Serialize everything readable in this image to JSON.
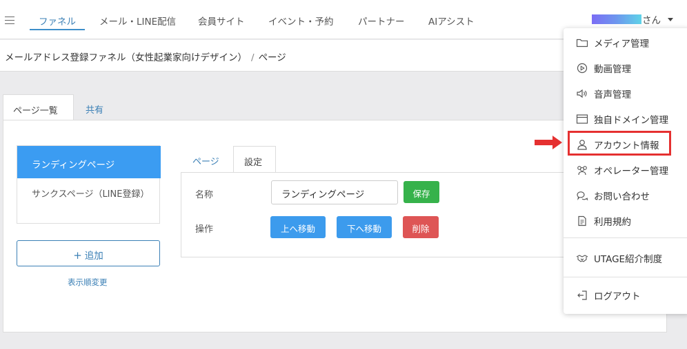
{
  "nav": {
    "tabs": [
      "ファネル",
      "メール・LINE配信",
      "会員サイト",
      "イベント・予約",
      "パートナー",
      "AIアシスト"
    ],
    "user_suffix": "さん"
  },
  "breadcrumb": {
    "funnel": "メールアドレス登録ファネル（女性起業家向けデザイン）",
    "separator": "/",
    "current": "ページ"
  },
  "page_tabs": [
    "ページ一覧",
    "共有"
  ],
  "page_list": {
    "items": [
      "ランディングページ",
      "サンクスページ（LINE登録）"
    ],
    "add_label": "追加",
    "reorder_label": "表示順変更"
  },
  "inner_tabs": [
    "ページ",
    "設定"
  ],
  "form": {
    "name_label": "名称",
    "name_value": "ランディングページ",
    "save_label": "保存",
    "ops_label": "操作",
    "move_up_label": "上へ移動",
    "move_down_label": "下へ移動",
    "delete_label": "削除"
  },
  "menu": {
    "items": [
      {
        "label": "メディア管理",
        "icon": "folder-icon"
      },
      {
        "label": "動画管理",
        "icon": "play-circle-icon"
      },
      {
        "label": "音声管理",
        "icon": "speaker-icon"
      },
      {
        "label": "独自ドメイン管理",
        "icon": "browser-window-icon"
      },
      {
        "label": "アカウント情報",
        "icon": "user-icon"
      },
      {
        "label": "オペレーター管理",
        "icon": "users-icon"
      },
      {
        "label": "お問い合わせ",
        "icon": "chat-bubbles-icon"
      },
      {
        "label": "利用規約",
        "icon": "document-icon"
      },
      {
        "label": "UTAGE紹介制度",
        "icon": "handshake-icon"
      },
      {
        "label": "ログアウト",
        "icon": "logout-icon"
      }
    ]
  },
  "colors": {
    "accent": "#3a7fb5",
    "primary_blue": "#3b9cf2",
    "save_green": "#36b24b",
    "delete_red": "#de5555",
    "highlight_red": "#e53030"
  }
}
